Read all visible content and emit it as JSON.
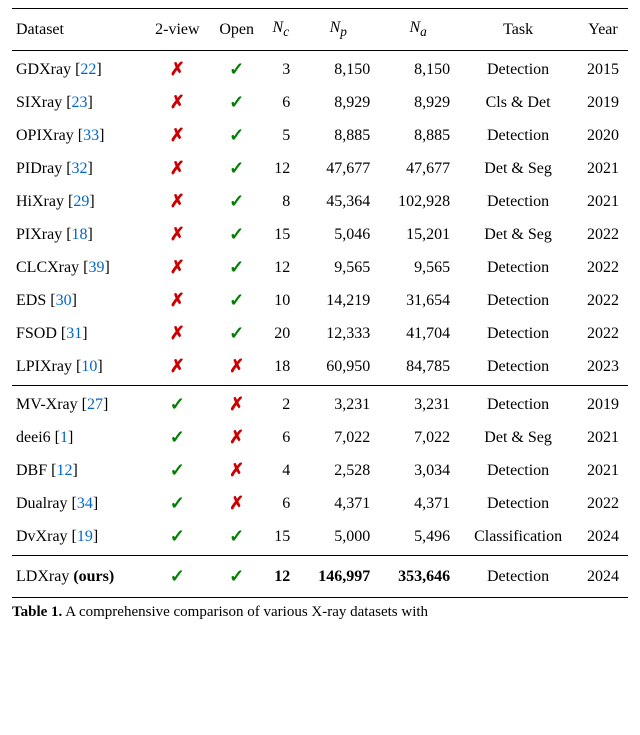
{
  "headers": {
    "dataset": "Dataset",
    "twoview": "2-view",
    "open": "Open",
    "nc": "N",
    "nc_sub": "c",
    "np": "N",
    "np_sub": "p",
    "na": "N",
    "na_sub": "a",
    "task": "Task",
    "year": "Year"
  },
  "rows": [
    {
      "name": "GDXray",
      "cite": "22",
      "twoview": false,
      "open": true,
      "nc": "3",
      "np": "8,150",
      "na": "8,150",
      "task": "Detection",
      "year": "2015"
    },
    {
      "name": "SIXray",
      "cite": "23",
      "twoview": false,
      "open": true,
      "nc": "6",
      "np": "8,929",
      "na": "8,929",
      "task": "Cls & Det",
      "year": "2019"
    },
    {
      "name": "OPIXray",
      "cite": "33",
      "twoview": false,
      "open": true,
      "nc": "5",
      "np": "8,885",
      "na": "8,885",
      "task": "Detection",
      "year": "2020"
    },
    {
      "name": "PIDray",
      "cite": "32",
      "twoview": false,
      "open": true,
      "nc": "12",
      "np": "47,677",
      "na": "47,677",
      "task": "Det & Seg",
      "year": "2021"
    },
    {
      "name": "HiXray",
      "cite": "29",
      "twoview": false,
      "open": true,
      "nc": "8",
      "np": "45,364",
      "na": "102,928",
      "task": "Detection",
      "year": "2021"
    },
    {
      "name": "PIXray",
      "cite": "18",
      "twoview": false,
      "open": true,
      "nc": "15",
      "np": "5,046",
      "na": "15,201",
      "task": "Det & Seg",
      "year": "2022"
    },
    {
      "name": "CLCXray",
      "cite": "39",
      "twoview": false,
      "open": true,
      "nc": "12",
      "np": "9,565",
      "na": "9,565",
      "task": "Detection",
      "year": "2022"
    },
    {
      "name": "EDS",
      "cite": "30",
      "twoview": false,
      "open": true,
      "nc": "10",
      "np": "14,219",
      "na": "31,654",
      "task": "Detection",
      "year": "2022"
    },
    {
      "name": "FSOD",
      "cite": "31",
      "twoview": false,
      "open": true,
      "nc": "20",
      "np": "12,333",
      "na": "41,704",
      "task": "Detection",
      "year": "2022"
    },
    {
      "name": "LPIXray",
      "cite": "10",
      "twoview": false,
      "open": false,
      "nc": "18",
      "np": "60,950",
      "na": "84,785",
      "task": "Detection",
      "year": "2023"
    },
    {
      "name": "MV-Xray",
      "cite": "27",
      "twoview": true,
      "open": false,
      "nc": "2",
      "np": "3,231",
      "na": "3,231",
      "task": "Detection",
      "year": "2019"
    },
    {
      "name": "deei6",
      "cite": "1",
      "twoview": true,
      "open": false,
      "nc": "6",
      "np": "7,022",
      "na": "7,022",
      "task": "Det & Seg",
      "year": "2021"
    },
    {
      "name": "DBF",
      "cite": "12",
      "twoview": true,
      "open": false,
      "nc": "4",
      "np": "2,528",
      "na": "3,034",
      "task": "Detection",
      "year": "2021"
    },
    {
      "name": "Dualray",
      "cite": "34",
      "twoview": true,
      "open": false,
      "nc": "6",
      "np": "4,371",
      "na": "4,371",
      "task": "Detection",
      "year": "2022"
    },
    {
      "name": "DvXray",
      "cite": "19",
      "twoview": true,
      "open": true,
      "nc": "15",
      "np": "5,000",
      "na": "5,496",
      "task": "Classification",
      "year": "2024"
    }
  ],
  "ours": {
    "name": "LDXray",
    "suffix": "(ours)",
    "twoview": true,
    "open": true,
    "nc": "12",
    "np": "146,997",
    "na": "353,646",
    "task": "Detection",
    "year": "2024"
  },
  "icons": {
    "check": "✓",
    "cross": "✗"
  },
  "caption": {
    "label": "Table 1.",
    "text_partial": " A comprehensive comparison of various X-ray datasets with"
  },
  "chart_data": {
    "type": "table",
    "title": "A comprehensive comparison of various X-ray datasets",
    "columns": [
      "Dataset",
      "2-view",
      "Open",
      "Nc",
      "Np",
      "Na",
      "Task",
      "Year"
    ],
    "rows": [
      [
        "GDXray",
        false,
        true,
        3,
        8150,
        8150,
        "Detection",
        2015
      ],
      [
        "SIXray",
        false,
        true,
        6,
        8929,
        8929,
        "Cls & Det",
        2019
      ],
      [
        "OPIXray",
        false,
        true,
        5,
        8885,
        8885,
        "Detection",
        2020
      ],
      [
        "PIDray",
        false,
        true,
        12,
        47677,
        47677,
        "Det & Seg",
        2021
      ],
      [
        "HiXray",
        false,
        true,
        8,
        45364,
        102928,
        "Detection",
        2021
      ],
      [
        "PIXray",
        false,
        true,
        15,
        5046,
        15201,
        "Det & Seg",
        2022
      ],
      [
        "CLCXray",
        false,
        true,
        12,
        9565,
        9565,
        "Detection",
        2022
      ],
      [
        "EDS",
        false,
        true,
        10,
        14219,
        31654,
        "Detection",
        2022
      ],
      [
        "FSOD",
        false,
        true,
        20,
        12333,
        41704,
        "Detection",
        2022
      ],
      [
        "LPIXray",
        false,
        false,
        18,
        60950,
        84785,
        "Detection",
        2023
      ],
      [
        "MV-Xray",
        true,
        false,
        2,
        3231,
        3231,
        "Detection",
        2019
      ],
      [
        "deei6",
        true,
        false,
        6,
        7022,
        7022,
        "Det & Seg",
        2021
      ],
      [
        "DBF",
        true,
        false,
        4,
        2528,
        3034,
        "Detection",
        2021
      ],
      [
        "Dualray",
        true,
        false,
        6,
        4371,
        4371,
        "Detection",
        2022
      ],
      [
        "DvXray",
        true,
        true,
        15,
        5000,
        5496,
        "Classification",
        2024
      ],
      [
        "LDXray (ours)",
        true,
        true,
        12,
        146997,
        353646,
        "Detection",
        2024
      ]
    ]
  }
}
